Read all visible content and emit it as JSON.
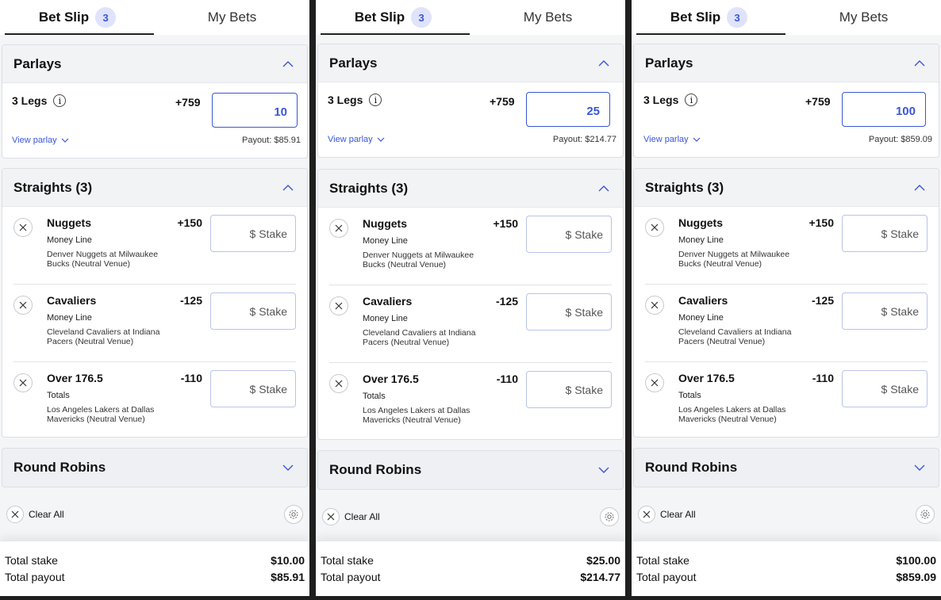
{
  "panels": [
    {
      "header": {
        "tab_betslip": "Bet Slip",
        "badge": "3",
        "tab_mybets": "My Bets"
      },
      "parlays": {
        "title": "Parlays",
        "legs": "3 Legs",
        "info": "i",
        "odds": "+759",
        "stake": "10",
        "view": "View parlay",
        "payout": "Payout: $85.91"
      },
      "straights": {
        "title": "Straights (3)",
        "items": [
          {
            "team": "Nuggets",
            "odds": "+150",
            "market": "Money Line",
            "event": "Denver Nuggets at Milwaukee Bucks (Neutral Venue)",
            "stake_placeholder": "$ Stake"
          },
          {
            "team": "Cavaliers",
            "odds": "-125",
            "market": "Money Line",
            "event": "Cleveland Cavaliers at Indiana Pacers (Neutral Venue)",
            "stake_placeholder": "$ Stake"
          },
          {
            "team": "Over 176.5",
            "odds": "-110",
            "market": "Totals",
            "event": "Los Angeles Lakers at Dallas Mavericks (Neutral Venue)",
            "stake_placeholder": "$ Stake"
          }
        ]
      },
      "round_robins": {
        "title": "Round Robins"
      },
      "clear_all": "Clear All",
      "footer": {
        "stake_label": "Total stake",
        "stake_value": "$10.00",
        "payout_label": "Total payout",
        "payout_value": "$85.91"
      }
    },
    {
      "header": {
        "tab_betslip": "Bet Slip",
        "badge": "3",
        "tab_mybets": "My Bets"
      },
      "parlays": {
        "title": "Parlays",
        "legs": "3 Legs",
        "info": "i",
        "odds": "+759",
        "stake": "25",
        "view": "View parlay",
        "payout": "Payout: $214.77"
      },
      "straights": {
        "title": "Straights (3)",
        "items": [
          {
            "team": "Nuggets",
            "odds": "+150",
            "market": "Money Line",
            "event": "Denver Nuggets at Milwaukee Bucks (Neutral Venue)",
            "stake_placeholder": "$ Stake"
          },
          {
            "team": "Cavaliers",
            "odds": "-125",
            "market": "Money Line",
            "event": "Cleveland Cavaliers at Indiana Pacers (Neutral Venue)",
            "stake_placeholder": "$ Stake"
          },
          {
            "team": "Over 176.5",
            "odds": "-110",
            "market": "Totals",
            "event": "Los Angeles Lakers at Dallas Mavericks (Neutral Venue)",
            "stake_placeholder": "$ Stake"
          }
        ]
      },
      "round_robins": {
        "title": "Round Robins"
      },
      "clear_all": "Clear All",
      "footer": {
        "stake_label": "Total stake",
        "stake_value": "$25.00",
        "payout_label": "Total payout",
        "payout_value": "$214.77"
      }
    },
    {
      "header": {
        "tab_betslip": "Bet Slip",
        "badge": "3",
        "tab_mybets": "My Bets"
      },
      "parlays": {
        "title": "Parlays",
        "legs": "3 Legs",
        "info": "i",
        "odds": "+759",
        "stake": "100",
        "view": "View parlay",
        "payout": "Payout: $859.09"
      },
      "straights": {
        "title": "Straights (3)",
        "items": [
          {
            "team": "Nuggets",
            "odds": "+150",
            "market": "Money Line",
            "event": "Denver Nuggets at Milwaukee Bucks (Neutral Venue)",
            "stake_placeholder": "$ Stake"
          },
          {
            "team": "Cavaliers",
            "odds": "-125",
            "market": "Money Line",
            "event": "Cleveland Cavaliers at Indiana Pacers (Neutral Venue)",
            "stake_placeholder": "$ Stake"
          },
          {
            "team": "Over 176.5",
            "odds": "-110",
            "market": "Totals",
            "event": "Los Angeles Lakers at Dallas Mavericks (Neutral Venue)",
            "stake_placeholder": "$ Stake"
          }
        ]
      },
      "round_robins": {
        "title": "Round Robins"
      },
      "clear_all": "Clear All",
      "footer": {
        "stake_label": "Total stake",
        "stake_value": "$100.00",
        "payout_label": "Total payout",
        "payout_value": "$859.09"
      }
    }
  ],
  "colors": {
    "accent": "#3a55d8",
    "badge_bg": "#dfe3fb",
    "section_bg": "#f2f3f5"
  },
  "icons": {
    "chevron_up": "chevron-up-icon",
    "chevron_down": "chevron-down-icon",
    "close": "close-icon",
    "info": "info-icon",
    "gear": "gear-icon"
  }
}
